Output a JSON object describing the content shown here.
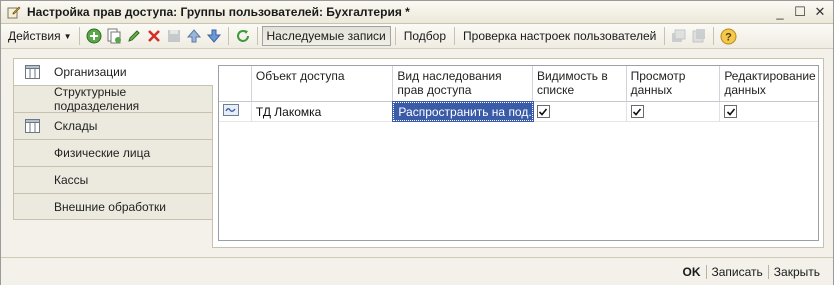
{
  "window": {
    "title": "Настройка прав доступа: Группы пользователей: Бухгалтерия *",
    "controls": {
      "minimize": "_",
      "maximize": "☐",
      "close": "✕"
    }
  },
  "toolbar": {
    "actions_label": "Действия",
    "inherited_label": "Наследуемые записи",
    "selection_label": "Подбор",
    "check_users_label": "Проверка настроек пользователей",
    "help_label": "?"
  },
  "tabs": [
    {
      "label": "Организации",
      "active": true,
      "icon": "table-icon"
    },
    {
      "label": "Структурные подразделения",
      "active": false,
      "icon": ""
    },
    {
      "label": "Склады",
      "active": false,
      "icon": "table-icon"
    },
    {
      "label": "Физические лица",
      "active": false,
      "icon": ""
    },
    {
      "label": "Кассы",
      "active": false,
      "icon": ""
    },
    {
      "label": "Внешние обработки",
      "active": false,
      "icon": ""
    }
  ],
  "grid": {
    "columns": [
      "",
      "Объект доступа",
      "Вид наследования прав доступа иерархических",
      "Видимость в списке",
      "Просмотр данных",
      "Редактирование данных"
    ],
    "rows": [
      {
        "object": "ТД Лакомка",
        "inheritance": "Распространить на под...",
        "visibility": true,
        "view": true,
        "edit": true
      }
    ]
  },
  "footer": {
    "ok_label": "OK",
    "save_label": "Записать",
    "close_label": "Закрыть"
  },
  "colors": {
    "selection": "#3a5ba8",
    "window_bg": "#f3f1e9"
  }
}
